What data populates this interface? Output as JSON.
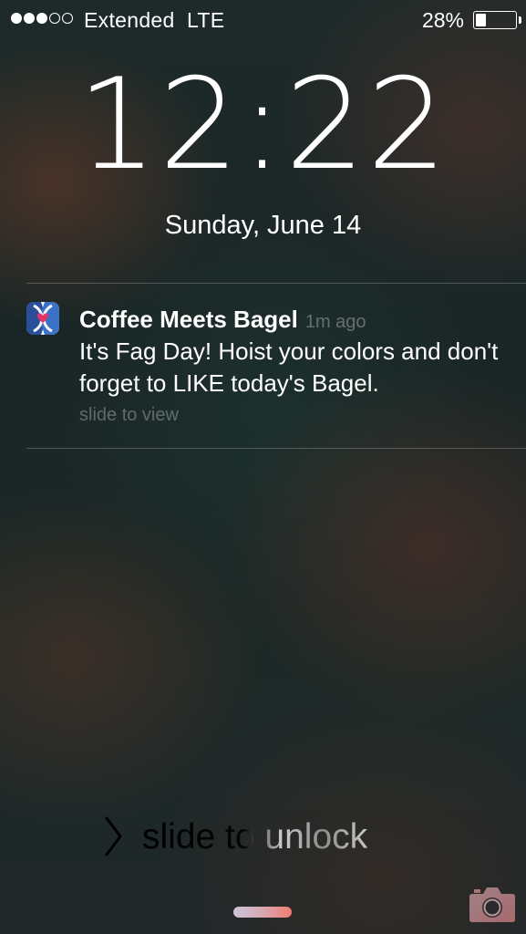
{
  "status_bar": {
    "signal_bars": 5,
    "signal_filled": 3,
    "carrier": "Extended",
    "network": "LTE",
    "battery_percent_label": "28%",
    "battery_level": 0.28
  },
  "lock_screen": {
    "time": "12:22",
    "date": "Sunday, June 14"
  },
  "notification": {
    "app_icon": "coffee-meets-bagel-app-icon",
    "app_name": "Coffee Meets Bagel",
    "time_ago": "1m ago",
    "message": "It's Fag Day! Hoist your colors and don't forget to LIKE today's Bagel.",
    "action_hint": "slide to view"
  },
  "unlock": {
    "chevron_icon": "chevron-right-icon",
    "label": "slide to unlock"
  },
  "bottom": {
    "grabber": "control-center-grabber",
    "camera_icon": "camera-icon"
  },
  "colors": {
    "text": "#ffffff",
    "muted": "rgba(255,255,255,0.32)",
    "grabber_accent": "#f07a72"
  }
}
